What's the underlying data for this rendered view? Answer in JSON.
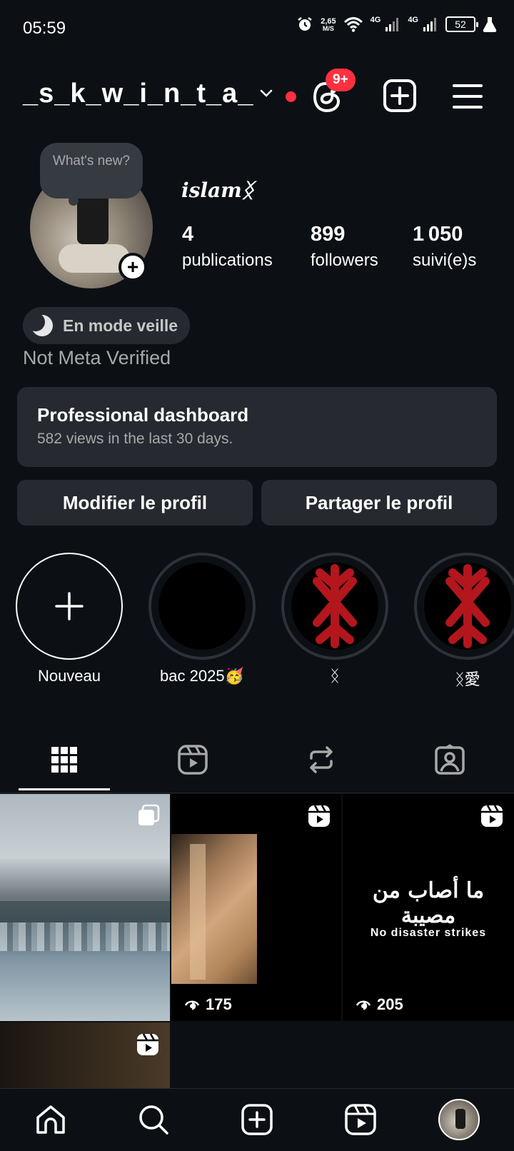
{
  "status_bar": {
    "time": "05:59",
    "net_speed_value": "2,65",
    "net_speed_unit": "M/S",
    "signal1_label": "4G",
    "signal2_label": "4G",
    "battery": "52"
  },
  "header": {
    "username": "_s_k_w_i_n_t_a_",
    "threads_badge": "9+"
  },
  "profile": {
    "note": "What's new?",
    "display_name": "islamᛝ",
    "stats": [
      {
        "value": "4",
        "label": "publications"
      },
      {
        "value": "899",
        "label": "followers"
      },
      {
        "value": "1 050",
        "label": "suivi(e)s"
      }
    ],
    "status_label": "En mode veille",
    "meta_verified": "Not Meta Verified"
  },
  "dashboard": {
    "title": "Professional dashboard",
    "subtitle": "582 views in the last 30 days."
  },
  "buttons": {
    "edit_profile": "Modifier le profil",
    "share_profile": "Partager le profil"
  },
  "highlights": [
    {
      "label": "Nouveau"
    },
    {
      "label": "bac 2025🥳"
    },
    {
      "label": "ᛝ"
    },
    {
      "label": "ᛝ愛"
    }
  ],
  "grid": {
    "posts": [
      {
        "type": "carousel"
      },
      {
        "type": "reel",
        "views": "175"
      },
      {
        "type": "reel",
        "views": "205",
        "overlay_arabic": "ما أصاب من مصيبة",
        "overlay_english": "No disaster strikes"
      },
      {
        "type": "reel"
      }
    ]
  },
  "colors": {
    "background": "#0c1014",
    "surface": "#262a30",
    "notification_red": "#ff3040",
    "highlight_symbol_red": "#b3161d"
  }
}
